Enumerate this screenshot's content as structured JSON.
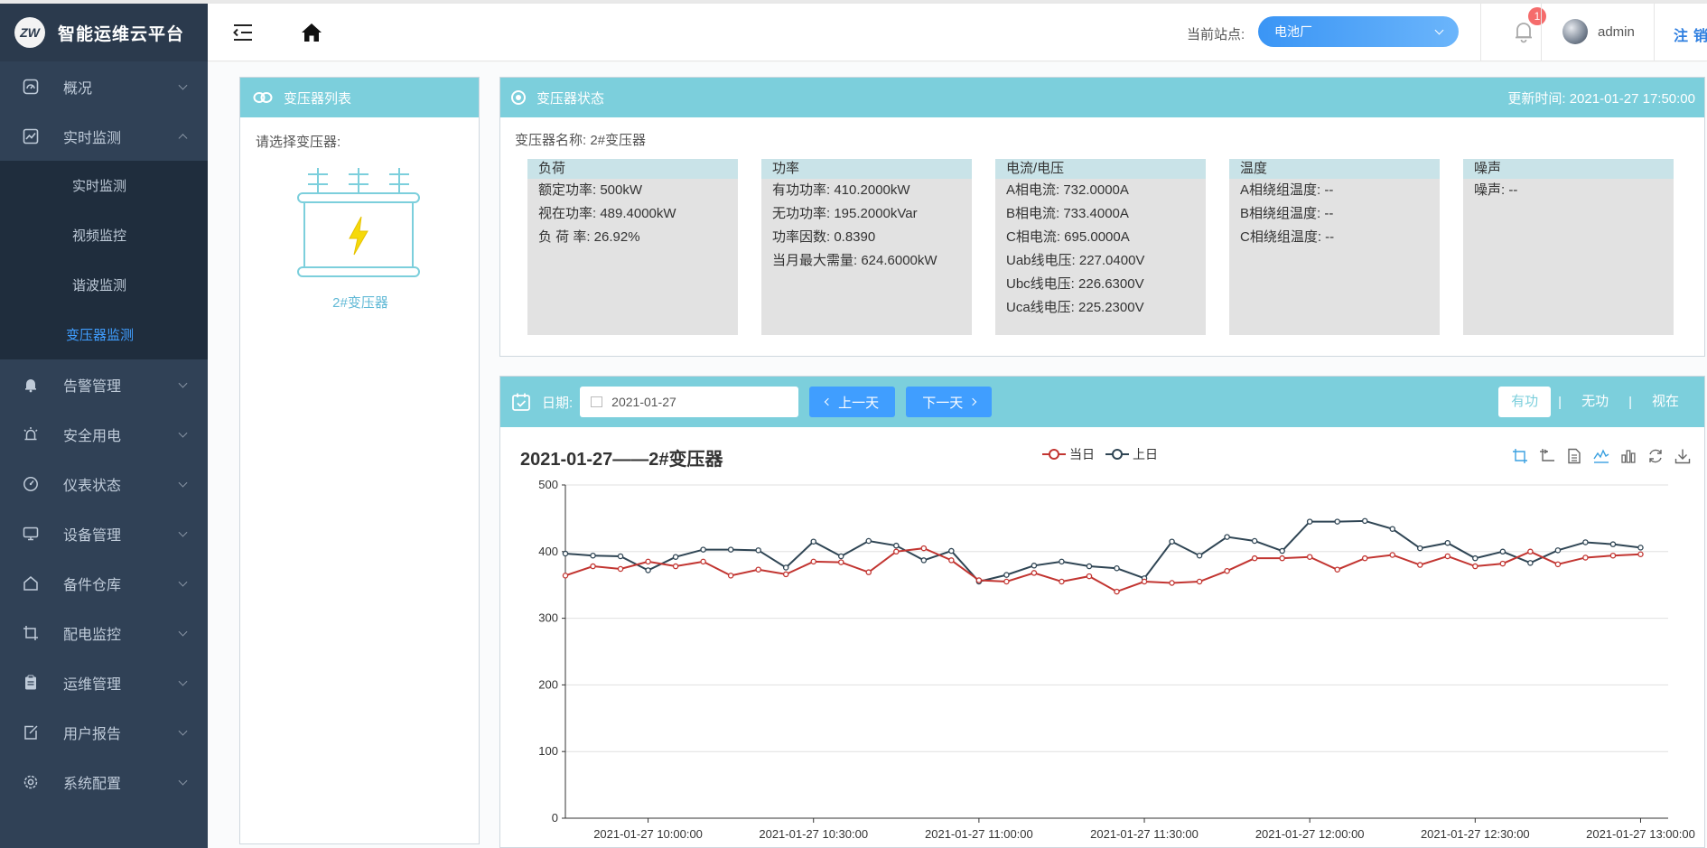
{
  "app": {
    "logo_text": "ZW",
    "title": "智能运维云平台"
  },
  "sidebar": {
    "items": [
      {
        "label": "概况",
        "icon": "dashboard-icon"
      },
      {
        "label": "实时监测",
        "icon": "chart-icon",
        "expanded": true
      },
      {
        "label": "告警管理",
        "icon": "bell-icon"
      },
      {
        "label": "安全用电",
        "icon": "alarm-light-icon"
      },
      {
        "label": "仪表状态",
        "icon": "gauge-icon"
      },
      {
        "label": "设备管理",
        "icon": "monitor-icon"
      },
      {
        "label": "备件仓库",
        "icon": "home-icon"
      },
      {
        "label": "配电监控",
        "icon": "crop-icon"
      },
      {
        "label": "运维管理",
        "icon": "clipboard-icon"
      },
      {
        "label": "用户报告",
        "icon": "edit-icon"
      },
      {
        "label": "系统配置",
        "icon": "settings-icon"
      }
    ],
    "submenu": [
      {
        "label": "实时监测"
      },
      {
        "label": "视频监控"
      },
      {
        "label": "谐波监测"
      },
      {
        "label": "变压器监测",
        "active": true
      }
    ]
  },
  "header": {
    "station_label": "当前站点:",
    "station_value": "电池厂",
    "notifications": "1",
    "username": "admin",
    "logout": "注销"
  },
  "transformer_list": {
    "title": "变压器列表",
    "choose_label": "请选择变压器:",
    "items": [
      {
        "name": "2#变压器"
      }
    ]
  },
  "status": {
    "title": "变压器状态",
    "update_time": "更新时间: 2021-01-27 17:50:00",
    "name_line": "变压器名称: 2#变压器",
    "cards": [
      {
        "title": "负荷",
        "rows": [
          "额定功率: 500kW",
          "视在功率: 489.4000kW",
          "负 荷 率: 26.92%"
        ]
      },
      {
        "title": "功率",
        "rows": [
          "有功功率: 410.2000kW",
          "无功功率: 195.2000kVar",
          "功率因数: 0.8390",
          "当月最大需量: 624.6000kW"
        ]
      },
      {
        "title": "电流/电压",
        "rows": [
          "A相电流: 732.0000A",
          "B相电流: 733.4000A",
          "C相电流: 695.0000A",
          "Uab线电压: 227.0400V",
          "Ubc线电压: 226.6300V",
          "Uca线电压: 225.2300V"
        ]
      },
      {
        "title": "温度",
        "rows": [
          "A相绕组温度: --",
          "B相绕组温度: --",
          "C相绕组温度: --"
        ]
      },
      {
        "title": "噪声",
        "rows": [
          "噪声: --"
        ]
      }
    ]
  },
  "chart_panel": {
    "date_label": "日期:",
    "date_value": "2021-01-27",
    "prev_day": "上一天",
    "next_day": "下一天",
    "modes": [
      "有功",
      "无功",
      "视在"
    ],
    "active_mode": "有功"
  },
  "colors": {
    "accent": "#7ccfdc",
    "primary": "#409eff",
    "today": "#c23531",
    "yesterday": "#2f4554"
  },
  "chart_data": {
    "type": "line",
    "title": "2021-01-27——2#变压器",
    "xlabel": "",
    "ylabel": "",
    "ylim": [
      0,
      500
    ],
    "yticks": [
      0,
      100,
      200,
      300,
      400,
      500
    ],
    "xticks": [
      "2021-01-27 10:00:00",
      "2021-01-27 10:30:00",
      "2021-01-27 11:00:00",
      "2021-01-27 11:30:00",
      "2021-01-27 12:00:00",
      "2021-01-27 12:30:00",
      "2021-01-27 13:00:00"
    ],
    "x_start": "2021-01-27 09:45:00",
    "x_step_minutes": 5,
    "grid": true,
    "legend": "top-center",
    "series": [
      {
        "name": "当日",
        "values": [
          364,
          378,
          374,
          385,
          378,
          385,
          364,
          373,
          366,
          385,
          384,
          369,
          400,
          405,
          387,
          357,
          355,
          368,
          355,
          363,
          340,
          355,
          353,
          355,
          371,
          390,
          390,
          392,
          373,
          390,
          395,
          380,
          393,
          378,
          382,
          400,
          381,
          391,
          394,
          396
        ]
      },
      {
        "name": "上日",
        "values": [
          397,
          394,
          393,
          372,
          392,
          403,
          403,
          402,
          376,
          415,
          393,
          416,
          409,
          387,
          401,
          355,
          365,
          379,
          385,
          378,
          375,
          360,
          415,
          394,
          422,
          416,
          401,
          445,
          445,
          446,
          434,
          405,
          413,
          390,
          400,
          383,
          402,
          414,
          411,
          406
        ]
      }
    ]
  }
}
